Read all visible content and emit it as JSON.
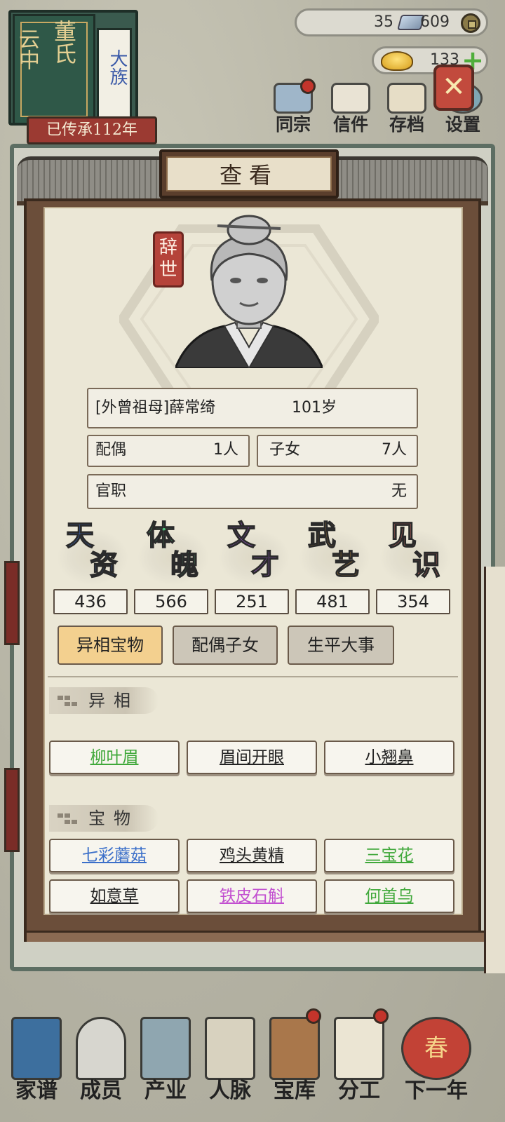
{
  "clan": {
    "region": "云中",
    "surname": "董氏",
    "rank": "大族",
    "inherit_text": "已传承112年"
  },
  "currency": {
    "silver": "35",
    "copper": "609",
    "gold": "133",
    "plus_label": "+"
  },
  "top_menu": [
    {
      "label": "同宗",
      "icon": "clan-books-icon",
      "badge": true
    },
    {
      "label": "信件",
      "icon": "letters-icon",
      "badge": false
    },
    {
      "label": "存档",
      "icon": "save-scroll-icon",
      "badge": false
    },
    {
      "label": "设置",
      "icon": "settings-icon",
      "badge": false
    }
  ],
  "dialog": {
    "title": "查看",
    "close_label": "✕",
    "status_stamp": "辞世",
    "person": {
      "name": "[外曾祖母]薛常绮",
      "age": "101岁"
    },
    "spouse": {
      "label": "配偶",
      "value": "1人"
    },
    "children": {
      "label": "子女",
      "value": "7人"
    },
    "office": {
      "label": "官职",
      "value": "无"
    },
    "stats": [
      {
        "ch1": "天",
        "ch2": "资",
        "value": "436",
        "color": "#3d6fd4"
      },
      {
        "ch1": "体",
        "ch2": "魄",
        "value": "566",
        "color": "#4fc07a"
      },
      {
        "ch1": "文",
        "ch2": "才",
        "value": "251",
        "color": "#a05ad0"
      },
      {
        "ch1": "武",
        "ch2": "艺",
        "value": "481",
        "color": "#e8a53a"
      },
      {
        "ch1": "见",
        "ch2": "识",
        "value": "354",
        "color": "#e07268"
      }
    ],
    "tabs": [
      "异相宝物",
      "配偶子女",
      "生平大事"
    ],
    "active_tab": 0,
    "sections": {
      "traits_title": "异相",
      "treasures_title": "宝物"
    },
    "traits": [
      {
        "label": "柳叶眉",
        "color": "#3fa83a"
      },
      {
        "label": "眉间开眼",
        "color": "#222222"
      },
      {
        "label": "小翘鼻",
        "color": "#222222"
      }
    ],
    "treasures": [
      {
        "label": "七彩蘑菇",
        "color": "#3b6fc9"
      },
      {
        "label": "鸡头黄精",
        "color": "#222222"
      },
      {
        "label": "三宝花",
        "color": "#3fa83a"
      },
      {
        "label": "如意草",
        "color": "#222222"
      },
      {
        "label": "铁皮石斛",
        "color": "#c24fd0"
      },
      {
        "label": "何首乌",
        "color": "#3fa83a"
      }
    ]
  },
  "bottom_nav": [
    {
      "label": "家谱",
      "icon": "genealogy-book-icon",
      "badge": false
    },
    {
      "label": "成员",
      "icon": "members-icon",
      "badge": false
    },
    {
      "label": "产业",
      "icon": "property-icon",
      "badge": false
    },
    {
      "label": "人脉",
      "icon": "network-icon",
      "badge": false
    },
    {
      "label": "宝库",
      "icon": "treasury-icon",
      "badge": true
    },
    {
      "label": "分工",
      "icon": "division-icon",
      "badge": true
    },
    {
      "label": "下一年",
      "icon": "next-year-lantern-icon",
      "badge": false,
      "lantern_char": "春"
    }
  ]
}
